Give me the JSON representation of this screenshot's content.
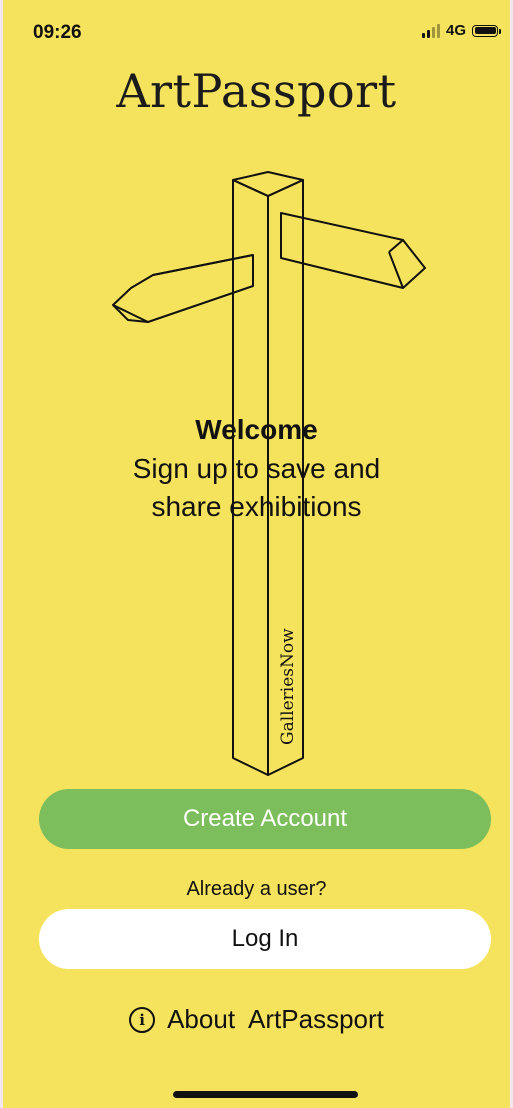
{
  "status_bar": {
    "time": "09:26",
    "network": "4G"
  },
  "app": {
    "title": "ArtPassport"
  },
  "illustration": {
    "post_label": "GalleriesNow"
  },
  "welcome": {
    "title": "Welcome",
    "subtitle_line1": "Sign up to save and",
    "subtitle_line2": "share exhibitions"
  },
  "actions": {
    "create_account_label": "Create Account",
    "already_user_text": "Already a user?",
    "login_label": "Log In",
    "about_label": "About  ArtPassport"
  },
  "colors": {
    "background": "#f6e35d",
    "create_button": "#7bbe5b",
    "login_button": "#ffffff",
    "text": "#111111"
  },
  "icons": {
    "about": "info-circle-icon",
    "battery": "battery-icon",
    "signal": "signal-icon"
  }
}
